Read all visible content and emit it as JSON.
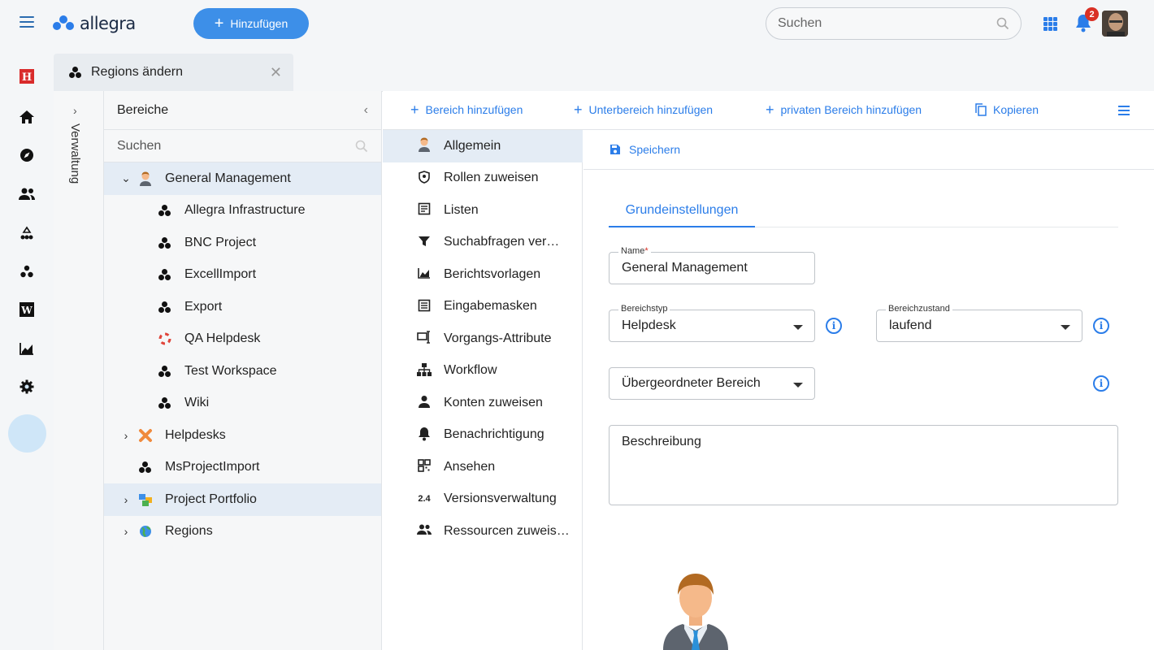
{
  "header": {
    "logo_text": "allegra",
    "add_button": "Hinzufügen",
    "search_placeholder": "Suchen",
    "notification_count": "2"
  },
  "leftnav": {
    "items": [
      "h-logo",
      "home",
      "compass",
      "users",
      "org-chart",
      "groups",
      "w-logo",
      "chart",
      "settings"
    ],
    "active": "settings"
  },
  "tab": {
    "label": "Regions ändern"
  },
  "side_panel": {
    "label": "Verwaltung"
  },
  "tree": {
    "title": "Bereiche",
    "search_placeholder": "Suchen",
    "items": [
      {
        "label": "General Management",
        "level": 0,
        "expanded": true,
        "selected": true,
        "icon": "person-icon"
      },
      {
        "label": "Allegra Infrastructure",
        "level": 1,
        "icon": "workspace-icon"
      },
      {
        "label": "BNC Project",
        "level": 1,
        "icon": "workspace-icon"
      },
      {
        "label": "ExcellImport",
        "level": 1,
        "icon": "workspace-icon"
      },
      {
        "label": "Export",
        "level": 1,
        "icon": "workspace-icon"
      },
      {
        "label": "QA Helpdesk",
        "level": 1,
        "icon": "lifebuoy-icon"
      },
      {
        "label": "Test Workspace",
        "level": 1,
        "icon": "workspace-icon"
      },
      {
        "label": "Wiki",
        "level": 1,
        "icon": "workspace-icon"
      },
      {
        "label": "Helpdesks",
        "level": 0,
        "collapsed": true,
        "icon": "tools-icon"
      },
      {
        "label": "MsProjectImport",
        "level": 0,
        "icon": "workspace-icon"
      },
      {
        "label": "Project Portfolio",
        "level": 0,
        "collapsed": true,
        "selected": true,
        "icon": "portfolio-icon"
      },
      {
        "label": "Regions",
        "level": 0,
        "collapsed": true,
        "icon": "globe-icon"
      }
    ]
  },
  "toolbar": {
    "add_area": "Bereich hinzufügen",
    "add_subarea": "Unterbereich hinzufügen",
    "add_private": "privaten Bereich hinzufügen",
    "copy": "Kopieren"
  },
  "menu": {
    "items": [
      {
        "label": "Allgemein",
        "icon": "person-icon",
        "selected": true
      },
      {
        "label": "Rollen zuweisen",
        "icon": "shield-icon"
      },
      {
        "label": "Listen",
        "icon": "list-icon"
      },
      {
        "label": "Suchabfragen ver…",
        "icon": "filter-icon"
      },
      {
        "label": "Berichtsvorlagen",
        "icon": "chart-icon"
      },
      {
        "label": "Eingabemasken",
        "icon": "form-icon"
      },
      {
        "label": "Vorgangs-Attribute",
        "icon": "attribute-icon"
      },
      {
        "label": "Workflow",
        "icon": "workflow-icon"
      },
      {
        "label": "Konten zuweisen",
        "icon": "account-icon"
      },
      {
        "label": "Benachrichtigung",
        "icon": "bell-icon"
      },
      {
        "label": "Ansehen",
        "icon": "view-icon"
      },
      {
        "label": "Versionsverwaltung",
        "icon": "version-icon",
        "glyph": "2.4"
      },
      {
        "label": "Ressourcen zuweis…",
        "icon": "resources-icon"
      }
    ]
  },
  "form": {
    "save": "Speichern",
    "tab": "Grundeinstellungen",
    "name_label": "Name",
    "name_value": "General Management",
    "type_label": "Bereichstyp",
    "type_value": "Helpdesk",
    "state_label": "Bereichzustand",
    "state_value": "laufend",
    "parent_value": "Übergeordneter Bereich",
    "description_placeholder": "Beschreibung"
  },
  "colors": {
    "accent": "#2b7de9",
    "button": "#3d8fe8",
    "selected": "#e4ecf5",
    "badge": "#d93025"
  }
}
